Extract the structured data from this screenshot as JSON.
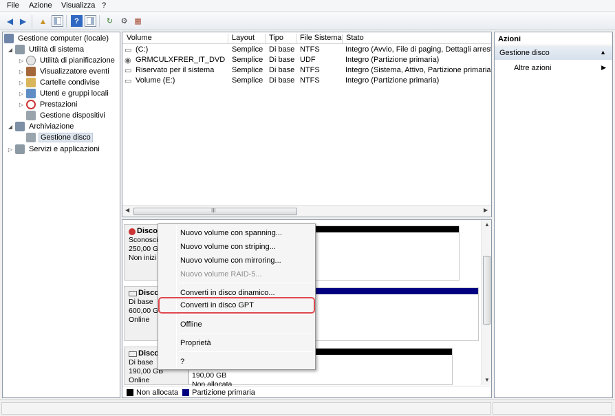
{
  "menubar": {
    "items": [
      "File",
      "Azione",
      "Visualizza",
      "?"
    ]
  },
  "toolbar": {
    "icons": [
      "back-arrow-icon",
      "forward-arrow-icon",
      "up-folder-icon",
      "show-hide-tree-icon",
      "help-icon",
      "show-hide-action-pane-icon",
      "refresh-icon",
      "properties-icon",
      "disk-settings-icon"
    ]
  },
  "tree": {
    "root": "Gestione computer (locale)",
    "items": [
      {
        "label": "Utilità di sistema"
      },
      {
        "label": "Utilità di pianificazione"
      },
      {
        "label": "Visualizzatore eventi"
      },
      {
        "label": "Cartelle condivise"
      },
      {
        "label": "Utenti e gruppi locali"
      },
      {
        "label": "Prestazioni"
      },
      {
        "label": "Gestione dispositivi"
      },
      {
        "label": "Archiviazione"
      },
      {
        "label": "Gestione disco"
      },
      {
        "label": "Servizi e applicazioni"
      }
    ]
  },
  "volumes": {
    "columns": [
      "Volume",
      "Layout",
      "Tipo",
      "File Sistema",
      "Stato"
    ],
    "rows": [
      {
        "volume": "(C:)",
        "layout": "Semplice",
        "tipo": "Di base",
        "fs": "NTFS",
        "stato": "Integro (Avvio, File di paging, Dettagli arresto"
      },
      {
        "volume": "GRMCULXFRER_IT_DVD (D:)",
        "layout": "Semplice",
        "tipo": "Di base",
        "fs": "UDF",
        "stato": "Integro (Partizione primaria)"
      },
      {
        "volume": "Riservato per il sistema",
        "layout": "Semplice",
        "tipo": "Di base",
        "fs": "NTFS",
        "stato": "Integro (Sistema, Attivo, Partizione primaria)"
      },
      {
        "volume": "Volume (E:)",
        "layout": "Semplice",
        "tipo": "Di base",
        "fs": "NTFS",
        "stato": "Integro (Partizione primaria)"
      }
    ],
    "scroll_marker": "III"
  },
  "disks": [
    {
      "name": "Disco",
      "type": "Sconosci",
      "size": "250,00 GB",
      "status": "Non inizi"
    },
    {
      "name": "Disco",
      "type": "Di base",
      "size": "600,00 GB",
      "status": "Online"
    },
    {
      "name": "Disco",
      "type": "Di base",
      "size": "190,00 GB",
      "status": "Online",
      "part_size": "190,00 GB",
      "part_status": "Non allocata"
    }
  ],
  "legend": {
    "unallocated": "Non allocata",
    "primary": "Partizione primaria"
  },
  "colors": {
    "unallocated": "#000000",
    "primary": "#000080",
    "highlight": "#e0474d"
  },
  "actions": {
    "title": "Azioni",
    "section": "Gestione disco",
    "item": "Altre azioni"
  },
  "context_menu": {
    "items": [
      {
        "label": "Nuovo volume con spanning..."
      },
      {
        "label": "Nuovo volume con striping..."
      },
      {
        "label": "Nuovo volume con mirroring..."
      },
      {
        "label": "Nuovo volume RAID-5..."
      },
      {
        "label": "Converti in disco dinamico..."
      },
      {
        "label": "Converti in disco GPT"
      },
      {
        "label": "Offline"
      },
      {
        "label": "Proprietà"
      },
      {
        "label": "?"
      }
    ]
  }
}
